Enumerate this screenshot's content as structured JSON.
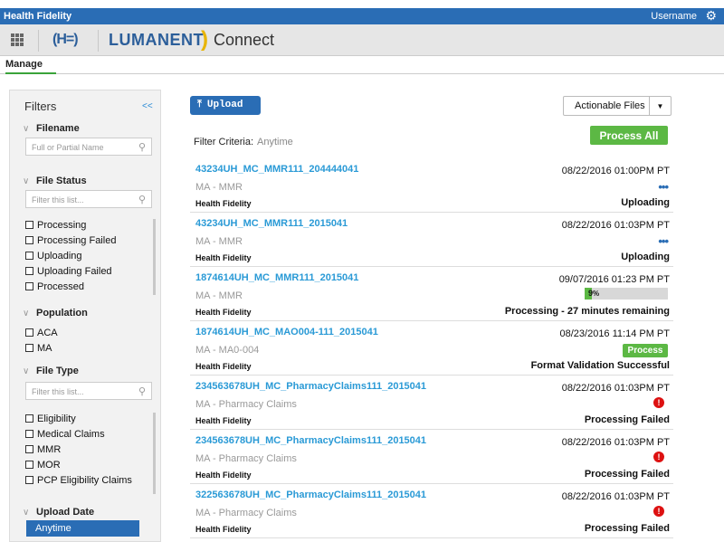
{
  "app": {
    "top_title": "Health Fidelity",
    "username": "Username",
    "gear_icon": "gear-icon",
    "hf_logo": "(H=)",
    "brand": "LUMANENT",
    "product": "Connect"
  },
  "tabs": {
    "manage": "Manage"
  },
  "sidebar": {
    "title": "Filters",
    "collapse": "<<",
    "filename": {
      "heading": "Filename",
      "placeholder": "Full or Partial Name"
    },
    "file_status": {
      "heading": "File Status",
      "placeholder": "Filter this list...",
      "items": [
        "Processing",
        "Processing Failed",
        "Uploading",
        "Uploading Failed",
        "Processed"
      ]
    },
    "population": {
      "heading": "Population",
      "items": [
        "ACA",
        "MA"
      ]
    },
    "file_type": {
      "heading": "File Type",
      "placeholder": "Filter this list...",
      "items": [
        "Eligibility",
        "Medical Claims",
        "MMR",
        "MOR",
        "PCP Eligibility Claims"
      ]
    },
    "upload_date": {
      "heading": "Upload Date",
      "selected": "Anytime"
    }
  },
  "toolbar": {
    "upload": "Upload",
    "actionable": "Actionable Files",
    "process_all": "Process All",
    "filter_label": "Filter Criteria:",
    "filter_value": "Anytime"
  },
  "files": [
    {
      "name": "43234UH_MC_MMR111_204444041",
      "type": "MA - MMR",
      "org": "Health Fidelity",
      "date": "08/22/2016  01:00PM PT",
      "status": "Uploading",
      "indicator": "dots",
      "dots": "•••"
    },
    {
      "name": "43234UH_MC_MMR111_2015041",
      "type": "MA - MMR",
      "org": "Health Fidelity",
      "date": "08/22/2016  01:03PM PT",
      "status": "Uploading",
      "indicator": "dots",
      "dots": "•••"
    },
    {
      "name": "1874614UH_MC_MMR111_2015041",
      "type": "MA - MMR",
      "org": "Health Fidelity",
      "date": "09/07/2016   01:23 PM PT",
      "status": "Processing - 27 minutes remaining",
      "indicator": "progress",
      "progress_pct": 9,
      "progress_label": "9"
    },
    {
      "name": "1874614UH_MC_MAO004-111_2015041",
      "type": "MA - MA0-004",
      "org": "Health Fidelity",
      "date": "08/23/2016 11:14 PM PT",
      "status": "Format Validation Successful",
      "indicator": "process",
      "process_label": "Process"
    },
    {
      "name": "234563678UH_MC_PharmacyClaims111_2015041",
      "type": "MA - Pharmacy Claims",
      "org": "Health Fidelity",
      "date": "08/22/2016  01:03PM PT",
      "status": "Processing Failed",
      "indicator": "error"
    },
    {
      "name": "234563678UH_MC_PharmacyClaims111_2015041",
      "type": "MA - Pharmacy Claims",
      "org": "Health Fidelity",
      "date": "08/22/2016  01:03PM PT",
      "status": "Processing Failed",
      "indicator": "error"
    },
    {
      "name": "322563678UH_MC_PharmacyClaims111_2015041",
      "type": "MA - Pharmacy Claims",
      "org": "Health Fidelity",
      "date": "08/22/2016  01:03PM PT",
      "status": "Processing Failed",
      "indicator": "error"
    }
  ]
}
